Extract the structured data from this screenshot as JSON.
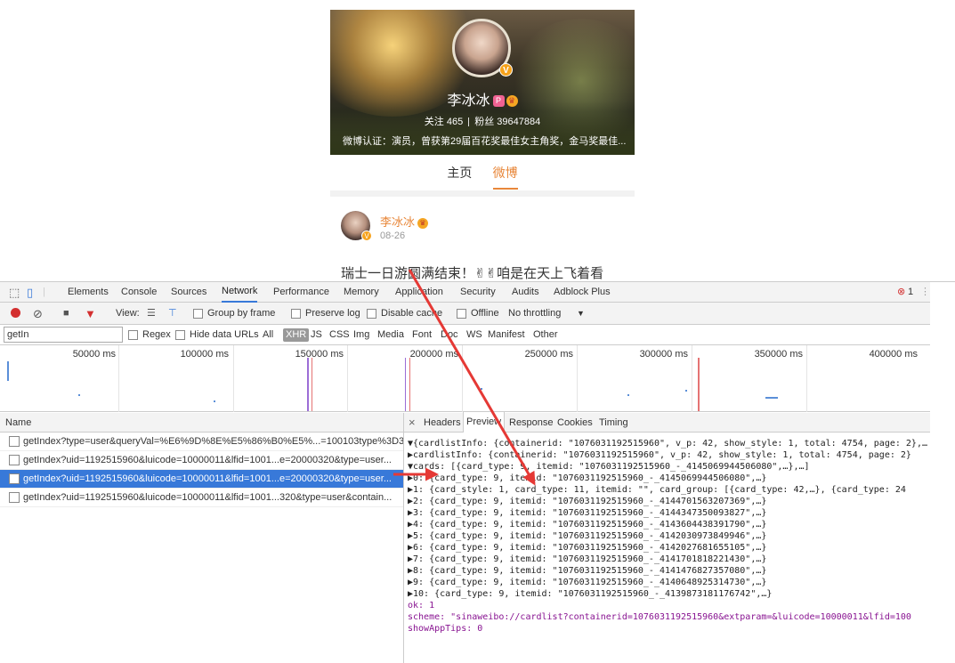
{
  "profile": {
    "name": "李冰冰",
    "vip_tag": "P",
    "verify_badge": "V",
    "following_label": "关注 465",
    "followers_label": "粉丝 39647884",
    "verified_text": "微博认证：演员，曾获第29届百花奖最佳女主角奖，金马奖最佳..."
  },
  "tabs": [
    {
      "label": "主页"
    },
    {
      "label": "微博"
    }
  ],
  "post": {
    "user": "李冰冰",
    "date": "08-26",
    "text": "瑞士一日游圆满结束！✌✌咱是在天上飞着看"
  },
  "devtools": {
    "tabs": [
      "Elements",
      "Console",
      "Sources",
      "Network",
      "Performance",
      "Memory",
      "Application",
      "Security",
      "Audits",
      "Adblock Plus"
    ],
    "error_count": "1",
    "toolbar": {
      "view_label": "View:",
      "group_by_frame": "Group by frame",
      "preserve_log": "Preserve log",
      "disable_cache": "Disable cache",
      "offline": "Offline",
      "throttling": "No throttling"
    },
    "filter": {
      "value": "getIn",
      "regex": "Regex",
      "hide_data_urls": "Hide data URLs",
      "types": [
        "All",
        "XHR",
        "JS",
        "CSS",
        "Img",
        "Media",
        "Font",
        "Doc",
        "WS",
        "Manifest",
        "Other"
      ],
      "active_type": "XHR"
    },
    "timeline_ticks": [
      "50000 ms",
      "100000 ms",
      "150000 ms",
      "200000 ms",
      "250000 ms",
      "300000 ms",
      "350000 ms",
      "400000 ms"
    ],
    "name_header": "Name",
    "requests": [
      "getIndex?type=user&queryVal=%E6%9D%8E%E5%86%B0%E5%...=100103type%3D3...",
      "getIndex?uid=1192515960&luicode=10000011&lfid=1001...e=20000320&type=user...",
      "getIndex?uid=1192515960&luicode=10000011&lfid=1001...e=20000320&type=user...",
      "getIndex?uid=1192515960&luicode=10000011&lfid=1001...320&type=user&contain..."
    ],
    "selected_request_index": 2,
    "detail_tabs": [
      "Headers",
      "Preview",
      "Response",
      "Cookies",
      "Timing"
    ],
    "active_detail_tab": "Preview",
    "close_glyph": "×",
    "preview_lines": [
      "▼{cardlistInfo: {containerid: \"1076031192515960\", v_p: 42, show_style: 1, total: 4754, page: 2},…",
      " ▶cardlistInfo: {containerid: \"1076031192515960\", v_p: 42, show_style: 1, total: 4754, page: 2}",
      " ▼cards: [{card_type: 9, itemid: \"1076031192515960_-_4145069944506080\",…},…]",
      "   ▶0: {card_type: 9, itemid: \"1076031192515960_-_4145069944506080\",…}",
      "   ▶1: {card_style: 1, card_type: 11, itemid: \"\", card_group: [{card_type: 42,…}, {card_type: 24",
      "   ▶2: {card_type: 9, itemid: \"1076031192515960_-_4144701563207369\",…}",
      "   ▶3: {card_type: 9, itemid: \"1076031192515960_-_4144347350093827\",…}",
      "   ▶4: {card_type: 9, itemid: \"1076031192515960_-_4143604438391790\",…}",
      "   ▶5: {card_type: 9, itemid: \"1076031192515960_-_4142030973849946\",…}",
      "   ▶6: {card_type: 9, itemid: \"1076031192515960_-_4142027681655105\",…}",
      "   ▶7: {card_type: 9, itemid: \"1076031192515960_-_4141701818221430\",…}",
      "   ▶8: {card_type: 9, itemid: \"1076031192515960_-_4141476827357080\",…}",
      "   ▶9: {card_type: 9, itemid: \"1076031192515960_-_4140648925314730\",…}",
      "   ▶10: {card_type: 9, itemid: \"1076031192515960_-_4139873181176742\",…}",
      "  ok: 1",
      "  scheme: \"sinaweibo://cardlist?containerid=1076031192515960&extparam=&luicode=10000011&lfid=100",
      "  showAppTips: 0"
    ]
  },
  "colors": {
    "accent": "#e8873a",
    "selection": "#3879d9",
    "annotation_arrow": "#e53935"
  }
}
